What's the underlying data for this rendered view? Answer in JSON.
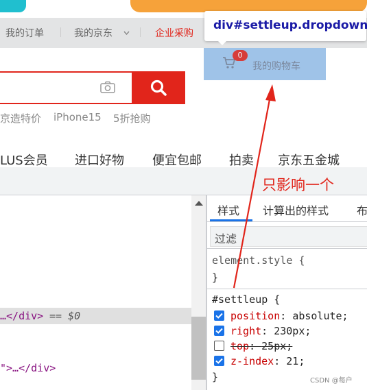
{
  "top_nav": {
    "items": [
      "我的订单",
      "我的京东",
      "企业采购"
    ],
    "separator": "|",
    "dropdown_arrow": "chevron-down-icon"
  },
  "tooltip": {
    "text": "div#settleup.dropdown"
  },
  "cart": {
    "badge_count": "0",
    "label": "我的购物车",
    "icon": "cart-icon"
  },
  "search": {
    "camera_icon": "camera-icon",
    "button_icon": "search-icon"
  },
  "hot_words": [
    "京造特价",
    "iPhone15",
    "5折抢购"
  ],
  "category_nav": [
    "LUS会员",
    "进口好物",
    "便宜包邮",
    "拍卖",
    "京东五金城"
  ],
  "annotation": "只影响一个",
  "elements": {
    "selected_line_tag": "…</div>",
    "selected_line_marker": "== $0",
    "other_line": "\">…</div>"
  },
  "styles": {
    "tabs": [
      "样式",
      "计算出的样式",
      "布"
    ],
    "filter_placeholder": "过滤",
    "element_style_selector": "element.style {",
    "element_style_close": "}",
    "rule_selector": "#settleup {",
    "rule_close": "}",
    "declarations": [
      {
        "prop": "position",
        "value": "absolute;",
        "checked": true,
        "struck": false
      },
      {
        "prop": "right",
        "value": "230px;",
        "checked": true,
        "struck": false
      },
      {
        "prop": "top",
        "value": "25px;",
        "checked": false,
        "struck": true
      },
      {
        "prop": "z-index",
        "value": "21;",
        "checked": true,
        "struck": false
      }
    ]
  },
  "watermark": "CSDN @每户",
  "colors": {
    "brand_red": "#e1251b",
    "highlight_blue": "#9fc3e8",
    "tooltip_text": "#1a1aa6",
    "css_property": "#c80000",
    "checkbox_blue": "#1a73e8"
  }
}
